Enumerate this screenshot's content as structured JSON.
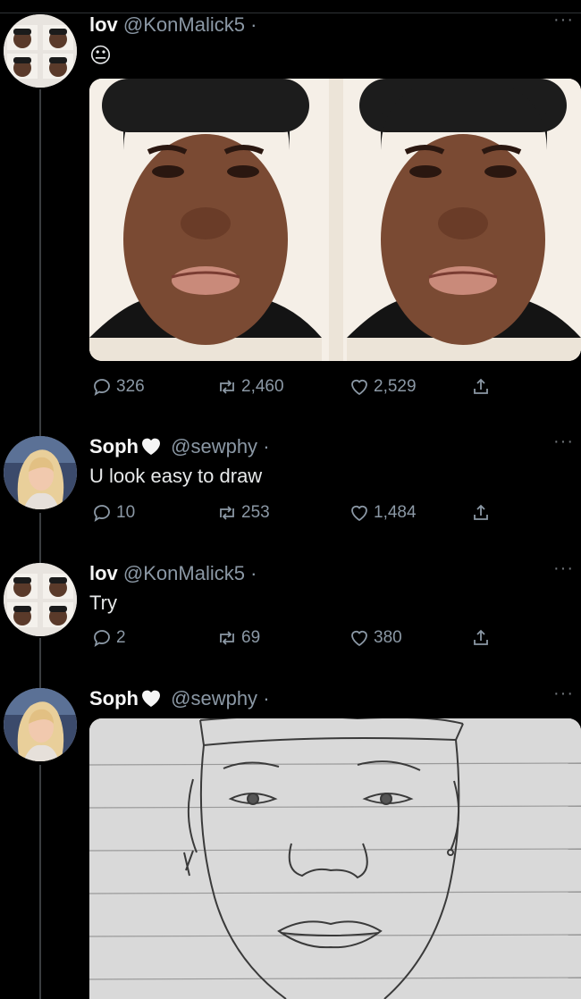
{
  "tweets": [
    {
      "name": "lov",
      "handle": "@KonMalick5",
      "separator": "·",
      "text": "😐",
      "replies": "326",
      "retweets": "2,460",
      "likes": "2,529",
      "avatar_icon": "grid-of-faces-avatar",
      "media": "two-portrait-photos"
    },
    {
      "name": "Soph",
      "handle": "@sewphy",
      "separator": "·",
      "text": "U look easy to draw",
      "replies": "10",
      "retweets": "253",
      "likes": "1,484",
      "avatar_icon": "blonde-woman-avatar"
    },
    {
      "name": "lov",
      "handle": "@KonMalick5",
      "separator": "·",
      "text": "Try",
      "replies": "2",
      "retweets": "69",
      "likes": "380",
      "avatar_icon": "grid-of-faces-avatar"
    },
    {
      "name": "Soph",
      "handle": "@sewphy",
      "separator": "·",
      "text": "",
      "avatar_icon": "blonde-woman-avatar",
      "media": "pencil-sketch-on-lined-paper"
    }
  ],
  "more_menu": "···",
  "colors": {
    "background": "#000000",
    "muted": "#8b98a5",
    "text": "#e7e9ea",
    "line": "#3a3d40"
  }
}
